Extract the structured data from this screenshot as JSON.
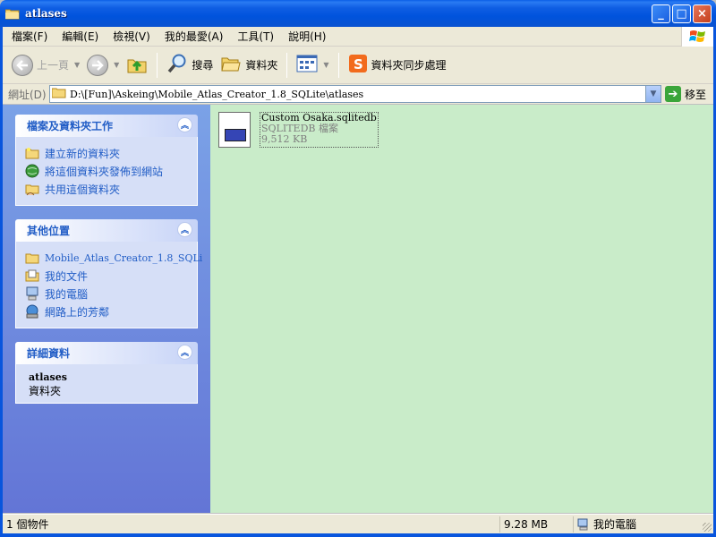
{
  "window": {
    "title": "atlases",
    "buttons": {
      "minimize": "_",
      "maximize": "□",
      "close": "×"
    }
  },
  "menu": {
    "items": [
      "檔案(F)",
      "編輯(E)",
      "檢視(V)",
      "我的最愛(A)",
      "工具(T)",
      "說明(H)"
    ]
  },
  "toolbar": {
    "back_label": "上一頁",
    "search_label": "搜尋",
    "folders_label": "資料夾",
    "sync_label": "資料夾同步處理"
  },
  "address": {
    "label": "網址(D)",
    "path": "D:\\[Fun]\\Askeing\\Mobile_Atlas_Creator_1.8_SQLite\\atlases",
    "go_label": "移至"
  },
  "sidebar": {
    "file_tasks": {
      "title": "檔案及資料夾工作",
      "items": [
        "建立新的資料夾",
        "將這個資料夾發佈到網站",
        "共用這個資料夾"
      ]
    },
    "other_places": {
      "title": "其他位置",
      "items": [
        "Mobile_Atlas_Creator_1.8_SQLi",
        "我的文件",
        "我的電腦",
        "網路上的芳鄰"
      ]
    },
    "details": {
      "title": "詳細資料",
      "name": "atlases",
      "type": "資料夾"
    }
  },
  "files": [
    {
      "name": "Custom Osaka.sqlitedb",
      "type": "SQLITEDB 檔案",
      "size": "9,512 KB"
    }
  ],
  "status": {
    "objects": "1 個物件",
    "size": "9.28 MB",
    "zone": "我的電腦"
  },
  "colors": {
    "titlebar": "#0053dd",
    "sidebar_link": "#215dc6",
    "content_bg": "#c9ecc9",
    "chrome_bg": "#ece9d8"
  },
  "icons": {
    "title": "folder-icon",
    "back": "back-arrow-icon",
    "forward": "forward-arrow-icon",
    "up": "folder-up-icon",
    "search": "magnifier-icon",
    "folders": "folders-icon",
    "views": "views-icon",
    "sync": "sync-icon"
  }
}
